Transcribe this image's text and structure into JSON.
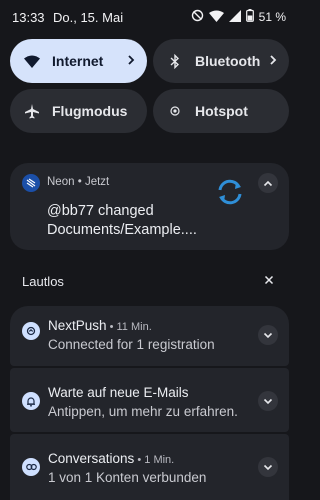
{
  "status_bar": {
    "time": "13:33",
    "date": "Do., 15. Mai",
    "battery": "51 %"
  },
  "tiles": {
    "internet": "Internet",
    "bluetooth": "Bluetooth",
    "airplane": "Flugmodus",
    "hotspot": "Hotspot"
  },
  "neon": {
    "app": "Neon",
    "time": "Jetzt",
    "message": "@bb77 changed Documents/Example...."
  },
  "silent_section": {
    "title": "Lautlos"
  },
  "notifications": [
    {
      "title": "NextPush",
      "meta": "11 Min.",
      "text": "Connected for 1 registration"
    },
    {
      "title": "Warte auf neue E-Mails",
      "meta": "",
      "text": "Antippen, um mehr zu erfahren."
    },
    {
      "title": "Conversations",
      "meta": "1 Min.",
      "text": "1 von 1 Konten verbunden"
    }
  ],
  "colors": {
    "background": "#16171b",
    "tile_on": "#d6e3fb",
    "tile_off": "#2b2d33",
    "card": "#23252b",
    "accent_sync": "#2f8fd8"
  }
}
